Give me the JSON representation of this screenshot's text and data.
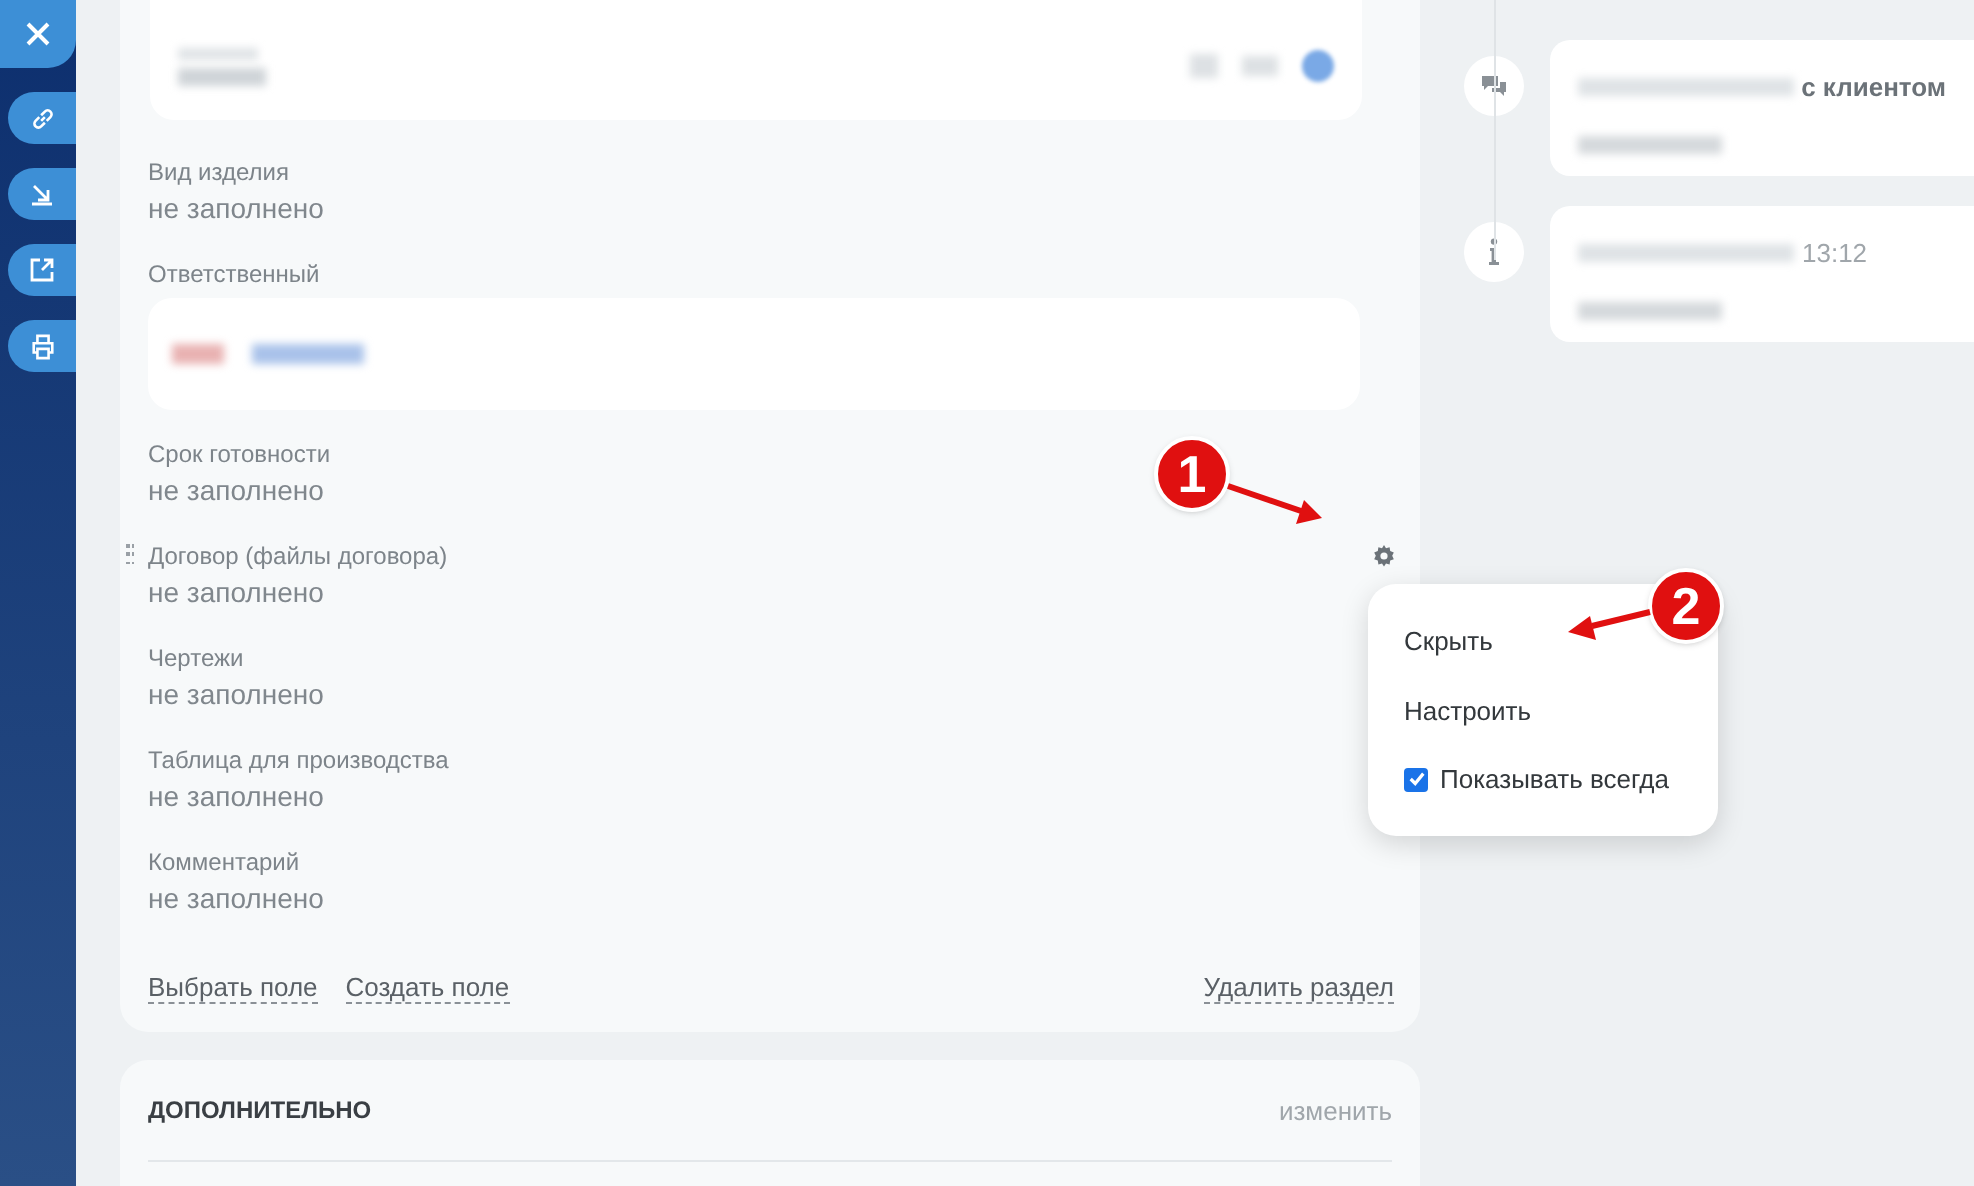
{
  "fields": [
    {
      "label": "Вид изделия",
      "value": "не заполнено",
      "menu_open": false
    },
    {
      "label": "Ответственный",
      "kind": "person"
    },
    {
      "label": "Срок готовности",
      "value": "не заполнено",
      "menu_open": false
    },
    {
      "label": "Договор (файлы договора)",
      "value": "не заполнено",
      "menu_open": true
    },
    {
      "label": "Чертежи",
      "value": "не заполнено",
      "menu_open": false
    },
    {
      "label": "Таблица для производства",
      "value": "не заполнено",
      "menu_open": false
    },
    {
      "label": "Комментарий",
      "value": "не заполнено",
      "menu_open": false
    }
  ],
  "section_links": [
    "Выбрать поле",
    "Создать поле"
  ],
  "delete_link": "Удалить раздел",
  "field_menu": [
    {
      "kind": "action",
      "label": "Скрыть"
    },
    {
      "kind": "action",
      "label": "Настроить"
    },
    {
      "kind": "checkbox",
      "label": "Показывать всегда",
      "checked": true
    }
  ],
  "section2": {
    "title": "ДОПОЛНИТЕЛЬНО",
    "action": "изменить"
  },
  "timeline": [
    {
      "kind": "comment",
      "text": "с клиентом"
    },
    {
      "kind": "info",
      "time": "13:12"
    }
  ],
  "annotations": [
    "1",
    "2"
  ]
}
